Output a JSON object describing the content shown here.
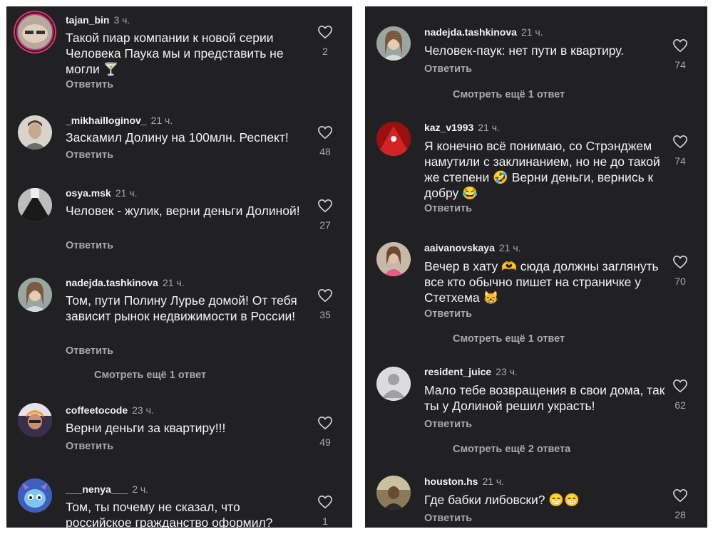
{
  "left": {
    "comments": [
      {
        "username": "tajan_bin",
        "time": "3 ч.",
        "text": "Такой пиар компании к новой серии Человека Паука мы и представить не могли 🍸",
        "reply": "Ответить",
        "likes": "2"
      },
      {
        "username": "_mikhailloginov_",
        "time": "21 ч.",
        "text": "Заскамил Долину на 100млн. Респект!",
        "reply": "Ответить",
        "likes": "48"
      },
      {
        "username": "osya.msk",
        "time": "21 ч.",
        "text": "Человек - жулик, верни деньги Долиной!",
        "reply": "Ответить",
        "likes": "27"
      },
      {
        "username": "nadejda.tashkinova",
        "time": "21 ч.",
        "text": "Том, пути Полину Лурье домой! От тебя зависит рынок недвижимости в России!",
        "reply": "Ответить",
        "likes": "35"
      },
      {
        "username": "coffeetocode",
        "time": "23 ч.",
        "text": "Верни деньги за квартиру!!!",
        "reply": "Ответить",
        "likes": "49"
      },
      {
        "username": "___nenya___",
        "time": "2 ч.",
        "text": "Том, ты почему не сказал, что российское гражданство оформил?",
        "reply": "",
        "likes": "1"
      }
    ],
    "more_replies": "Смотреть ещё 1 ответ"
  },
  "right": {
    "comments": [
      {
        "username": "nadejda.tashkinova",
        "time": "21 ч.",
        "text": "Человек-паук: нет пути в квартиру.",
        "reply": "Ответить",
        "likes": "74"
      },
      {
        "username": "kaz_v1993",
        "time": "21 ч.",
        "text": "Я конечно всё понимаю, со Стрэнджем намутили с заклинанием, но не до такой же степени 🤣 Верни деньги, вернись к добру 😂",
        "reply": "Ответить",
        "likes": "74"
      },
      {
        "username": "aaivanovskaya",
        "time": "21 ч.",
        "text": "Вечер в хату 🫶 сюда должны заглянуть все кто обычно пишет на страничке у Стетхема 😸",
        "reply": "Ответить",
        "likes": "70"
      },
      {
        "username": "resident_juice",
        "time": "23 ч.",
        "text": "Мало тебе возвращения в свои дома, так ты у Долиной решил украсть!",
        "reply": "Ответить",
        "likes": "62"
      },
      {
        "username": "houston.hs",
        "time": "21 ч.",
        "text": "Где бабки либовски? 😁😁",
        "reply": "Ответить",
        "likes": "28"
      }
    ],
    "more_1": "Смотреть ещё 1 ответ",
    "more_2": "Смотреть ещё 1 ответ",
    "more_3": "Смотреть ещё 2 ответа"
  }
}
